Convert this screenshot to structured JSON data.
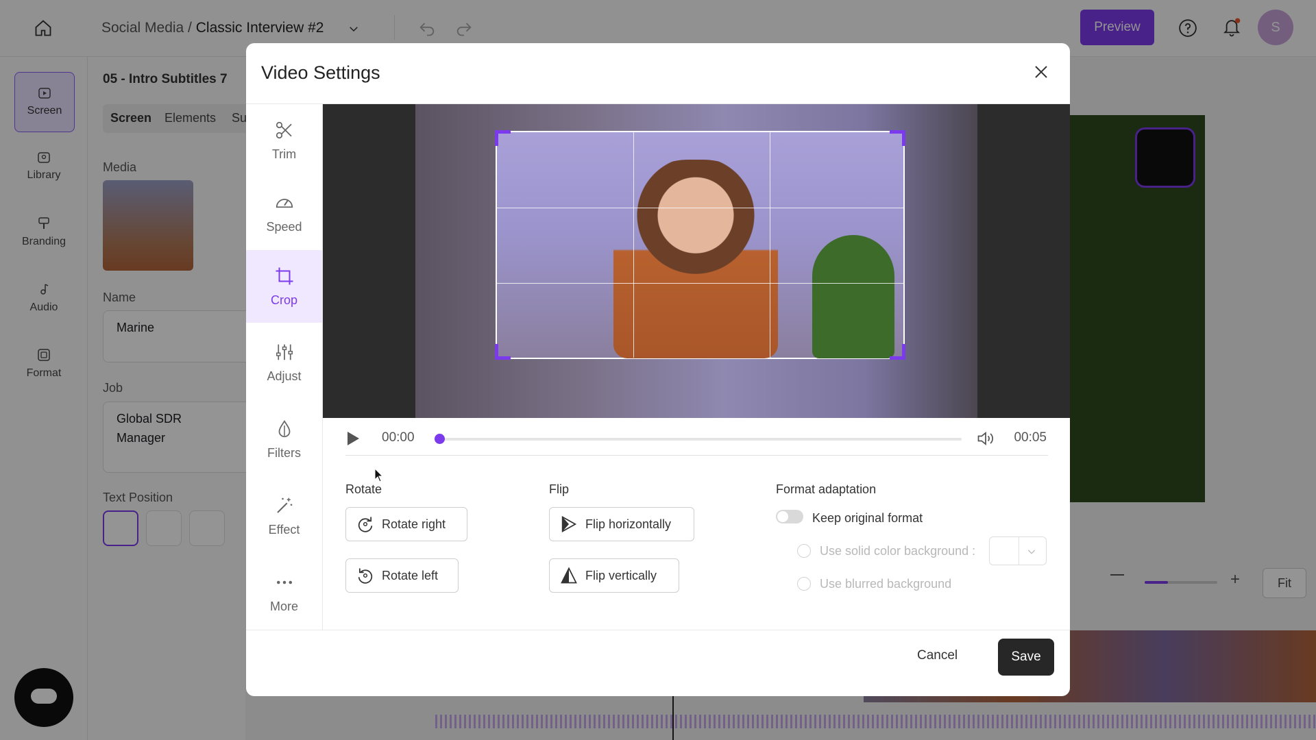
{
  "topbar": {
    "project_path": "Social Media / ",
    "project_name": "Classic Interview #2",
    "preview_label": "Preview",
    "avatar_initial": "S"
  },
  "rail": {
    "items": [
      {
        "label": "Screen",
        "icon": "screen-icon"
      },
      {
        "label": "Library",
        "icon": "library-icon"
      },
      {
        "label": "Branding",
        "icon": "branding-icon"
      },
      {
        "label": "Audio",
        "icon": "audio-icon"
      },
      {
        "label": "Format",
        "icon": "format-icon"
      }
    ]
  },
  "panel": {
    "scene_title": "05 - Intro Subtitles 7",
    "tabs": [
      "Screen",
      "Elements",
      "Su"
    ],
    "media_label": "Media",
    "name_label": "Name",
    "name_value": "Marine",
    "job_label": "Job",
    "job_value_line1": "Global SDR",
    "job_value_line2": "Manager",
    "text_position_label": "Text Position"
  },
  "zoom": {
    "fit_label": "Fit"
  },
  "modal": {
    "title": "Video Settings",
    "tools": [
      {
        "label": "Trim",
        "icon": "scissors-icon"
      },
      {
        "label": "Speed",
        "icon": "speedometer-icon"
      },
      {
        "label": "Crop",
        "icon": "crop-icon"
      },
      {
        "label": "Adjust",
        "icon": "sliders-icon"
      },
      {
        "label": "Filters",
        "icon": "drop-icon"
      },
      {
        "label": "Effect",
        "icon": "magic-wand-icon"
      },
      {
        "label": "More",
        "icon": "more-dots-icon"
      }
    ],
    "player": {
      "current_time": "00:00",
      "end_time": "00:05",
      "progress": 0.0
    },
    "rotate": {
      "title": "Rotate",
      "right_label": "Rotate right",
      "left_label": "Rotate left"
    },
    "flip": {
      "title": "Flip",
      "horizontal_label": "Flip horizontally",
      "vertical_label": "Flip vertically"
    },
    "format": {
      "title": "Format adaptation",
      "keep_original_label": "Keep original format",
      "keep_original_on": false,
      "solid_color_label": "Use solid color background :",
      "blurred_label": "Use blurred background"
    },
    "cancel_label": "Cancel",
    "save_label": "Save"
  },
  "colors": {
    "accent": "#7c3aed",
    "dark_button": "#272727"
  }
}
